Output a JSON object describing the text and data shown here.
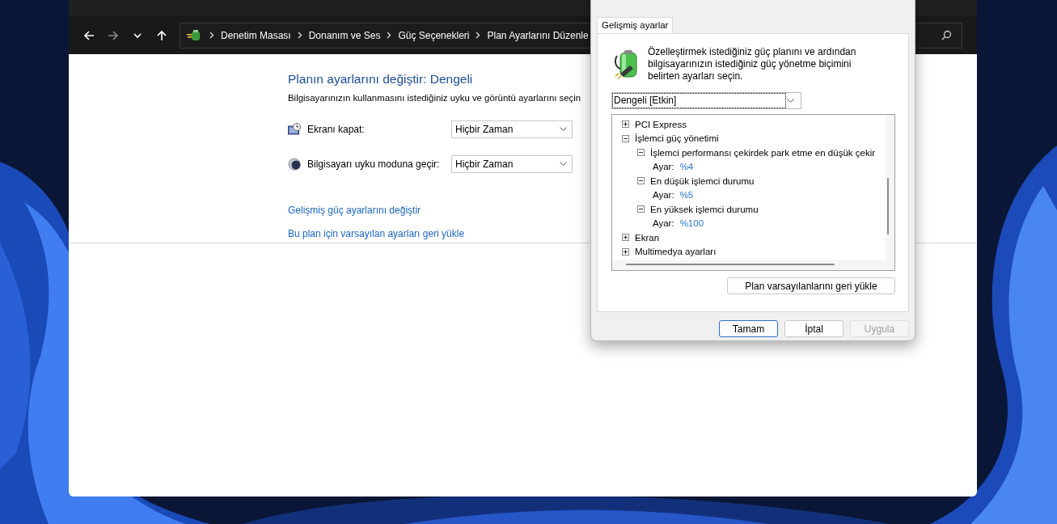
{
  "explorer": {
    "nav_buttons": [
      {
        "kind": "back",
        "disabled": false
      },
      {
        "kind": "forward",
        "disabled": true
      },
      {
        "kind": "recent",
        "disabled": false
      },
      {
        "kind": "up",
        "disabled": false
      }
    ],
    "breadcrumb": [
      "Denetim Masası",
      "Donanım ve Ses",
      "Güç Seçenekleri",
      "Plan Ayarlarını Düzenle"
    ],
    "heading": "Planın ayarlarını değiştir: Dengeli",
    "description": "Bilgisayarınızın kullanmasını istediğiniz uyku ve görüntü ayarlarını seçin",
    "settings": [
      {
        "kind": "display",
        "label": "Ekranı kapat:",
        "value": "Hiçbir Zaman"
      },
      {
        "kind": "sleep",
        "label": "Bilgisayarı uyku moduna geçir:",
        "value": "Hiçbir Zaman"
      }
    ],
    "links": [
      "Gelişmiş güç ayarlarını değiştir",
      "Bu plan için varsayılan ayarları geri yükle"
    ]
  },
  "dialog": {
    "tabs": [
      {
        "label": "Gelişmiş ayarlar",
        "selected": true
      }
    ],
    "intro": "Özelleştirmek istediğiniz güç planını ve ardından bilgisayarınızın istediğiniz güç yönetme biçimini belirten ayarları seçin.",
    "plan_select": {
      "value": "Dengeli [Etkin]"
    },
    "tree": [
      {
        "label": "PCI Express",
        "expanded": false
      },
      {
        "label": "İşlemci güç yönetimi",
        "expanded": true,
        "children": [
          {
            "label": "İşlemci performansı çekirdek park etme en düşük çekir",
            "expanded": true,
            "children": [
              {
                "kind": "setting",
                "label": "Ayar:",
                "value": "%4"
              }
            ]
          },
          {
            "label": "En düşük işlemci durumu",
            "expanded": true,
            "children": [
              {
                "kind": "setting",
                "label": "Ayar:",
                "value": "%5"
              }
            ]
          },
          {
            "label": "En yüksek işlemci durumu",
            "expanded": true,
            "children": [
              {
                "kind": "setting",
                "label": "Ayar:",
                "value": "%100"
              }
            ]
          }
        ]
      },
      {
        "label": "Ekran",
        "expanded": false
      },
      {
        "label": "Multimedya ayarları",
        "expanded": false
      }
    ],
    "restore_button": "Plan varsayılanlarını geri yükle",
    "buttons": [
      {
        "kind": "default",
        "label": "Tamam",
        "disabled": false
      },
      {
        "kind": "normal",
        "label": "İptal",
        "disabled": false
      },
      {
        "kind": "normal",
        "label": "Uygula",
        "disabled": true
      }
    ]
  }
}
